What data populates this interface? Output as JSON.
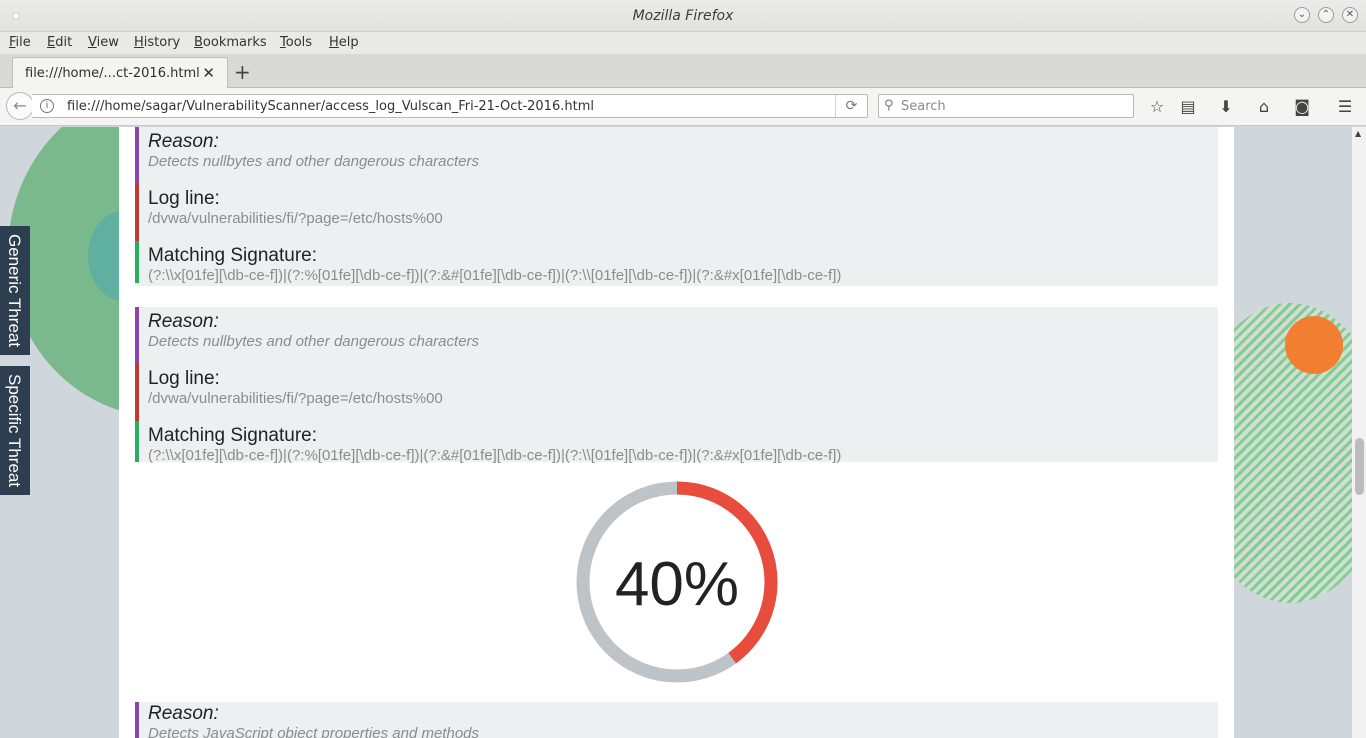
{
  "window": {
    "title": "Mozilla Firefox"
  },
  "menu": [
    "File",
    "Edit",
    "View",
    "History",
    "Bookmarks",
    "Tools",
    "Help"
  ],
  "tab": {
    "title": "file:///home/...ct-2016.html"
  },
  "navbar": {
    "url": "file:///home/sagar/VulnerabilityScanner/access_log_Vulscan_Fri-21-Oct-2016.html",
    "search_placeholder": "Search"
  },
  "side_tabs": {
    "generic": "Generic Threat",
    "specific": "Specific Threat"
  },
  "labels": {
    "reason": "Reason:",
    "log_line": "Log line:",
    "signature": "Matching Signature:"
  },
  "entries": [
    {
      "reason": "Detects nullbytes and other dangerous characters",
      "log_line": "/dvwa/vulnerabilities/fi/?page=/etc/hosts%00",
      "signature": "(?:\\\\x[01fe][\\db-ce-f])|(?:%[01fe][\\db-ce-f])|(?:&#[01fe][\\db-ce-f])|(?:\\\\[01fe][\\db-ce-f])|(?:&#x[01fe][\\db-ce-f])"
    },
    {
      "reason": "Detects nullbytes and other dangerous characters",
      "log_line": "/dvwa/vulnerabilities/fi/?page=/etc/hosts%00",
      "signature": "(?:\\\\x[01fe][\\db-ce-f])|(?:%[01fe][\\db-ce-f])|(?:&#[01fe][\\db-ce-f])|(?:\\\\[01fe][\\db-ce-f])|(?:&#x[01fe][\\db-ce-f])"
    },
    {
      "reason": "Detects JavaScript object properties and methods"
    }
  ],
  "progress": {
    "label": "40%",
    "value": 0.4,
    "fill_color": "#e74c3c",
    "track_color": "#bdc3c7"
  }
}
